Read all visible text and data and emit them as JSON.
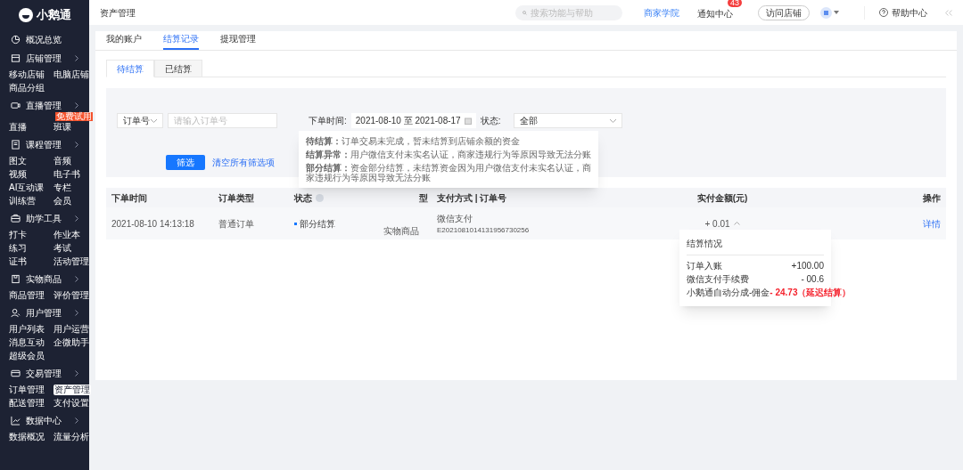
{
  "sidebar": {
    "logo": "小鹅通",
    "groups": [
      {
        "label": "概况总览"
      },
      {
        "label": "店铺管理",
        "items": [
          {
            "label": "移动店铺",
            "selected": false
          },
          {
            "label": "电脑店铺",
            "selected": false
          },
          {
            "label": "商品分组",
            "selected": false
          }
        ]
      },
      {
        "label": "直播管理",
        "items": [
          {
            "label": "直播",
            "selected": false
          },
          {
            "label": "班课",
            "selected": false,
            "badge": "免费试用"
          }
        ]
      },
      {
        "label": "课程管理",
        "items": [
          {
            "label": "图文",
            "selected": false
          },
          {
            "label": "音频",
            "selected": false
          },
          {
            "label": "视频",
            "selected": false
          },
          {
            "label": "电子书",
            "selected": false
          },
          {
            "label": "AI互动课",
            "selected": false
          },
          {
            "label": "专栏",
            "selected": false
          },
          {
            "label": "训练营",
            "selected": false
          },
          {
            "label": "会员",
            "selected": false
          }
        ]
      },
      {
        "label": "助学工具",
        "items": [
          {
            "label": "打卡",
            "selected": false
          },
          {
            "label": "作业本",
            "selected": false
          },
          {
            "label": "练习",
            "selected": false
          },
          {
            "label": "考试",
            "selected": false
          },
          {
            "label": "证书",
            "selected": false
          },
          {
            "label": "活动管理",
            "selected": false
          }
        ]
      },
      {
        "label": "实物商品",
        "items": [
          {
            "label": "商品管理",
            "selected": false
          },
          {
            "label": "评价管理",
            "selected": false
          }
        ]
      },
      {
        "label": "用户管理",
        "items": [
          {
            "label": "用户列表",
            "selected": false
          },
          {
            "label": "用户运营",
            "selected": false
          },
          {
            "label": "消息互动",
            "selected": false
          },
          {
            "label": "企微助手",
            "selected": false
          },
          {
            "label": "超级会员",
            "selected": false
          }
        ]
      },
      {
        "label": "交易管理",
        "items": [
          {
            "label": "订单管理",
            "selected": false
          },
          {
            "label": "资产管理",
            "selected": true
          },
          {
            "label": "配送管理",
            "selected": false
          },
          {
            "label": "支付设置",
            "selected": false
          }
        ]
      },
      {
        "label": "数据中心",
        "items": [
          {
            "label": "数据概况",
            "selected": false
          },
          {
            "label": "流量分析",
            "selected": false
          }
        ]
      }
    ]
  },
  "topbar": {
    "title": "资产管理",
    "search_placeholder": "搜索功能与帮助",
    "academy": "商家学院",
    "notices": "通知中心",
    "notice_count": "43",
    "visit": "访问店铺",
    "help": "帮助中心"
  },
  "tabs": [
    {
      "label": "我的账户",
      "selected": false
    },
    {
      "label": "结算记录",
      "selected": true
    },
    {
      "label": "提现管理",
      "selected": false
    }
  ],
  "subtabs": [
    {
      "label": "待结算",
      "selected": true
    },
    {
      "label": "已结算",
      "selected": false
    }
  ],
  "filter": {
    "type_select": "订单号",
    "order_placeholder": "请输入订单号",
    "date_label": "下单时间:",
    "date_value": "2021-08-10 至 2021-08-17",
    "status_label": "状态:",
    "status_value": "全部",
    "submit": "筛选",
    "clear": "清空所有筛选项"
  },
  "table": {
    "columns": [
      "下单时间",
      "订单类型",
      "状态",
      "型",
      "支付方式 | 订单号",
      "实付金额(元)",
      "操作"
    ],
    "rows": [
      {
        "time": "2021-08-10 14:13:18",
        "type": "普通订单",
        "status": "部分结算",
        "goods": "实物商品",
        "pay": "微信支付",
        "order_no": "E2021081014131956730256",
        "amount": "+ 0.01",
        "action": "详情"
      }
    ]
  },
  "status_tooltip": [
    "**待结算：**订单交易未完成，暂未结算到店铺余额的资金",
    "**结算异常：**用户微信支付未实名认证，商家违规行为等原因导致无法分账",
    "**部分结算：**资金部分结算，未结算资金因为用户微信支付未实名认证，商家违规行为等原因导致无法分账"
  ],
  "settlement_popover": {
    "title": "结算情况",
    "rows": [
      {
        "label": "订单入账",
        "value": "+100.00",
        "highlight": false
      },
      {
        "label": "微信支付手续费",
        "value": "-  00.6",
        "highlight": false
      },
      {
        "label": "小鹅通自动分成-佣金",
        "value": "-  24.73（延迟结算）",
        "highlight": true
      }
    ]
  }
}
